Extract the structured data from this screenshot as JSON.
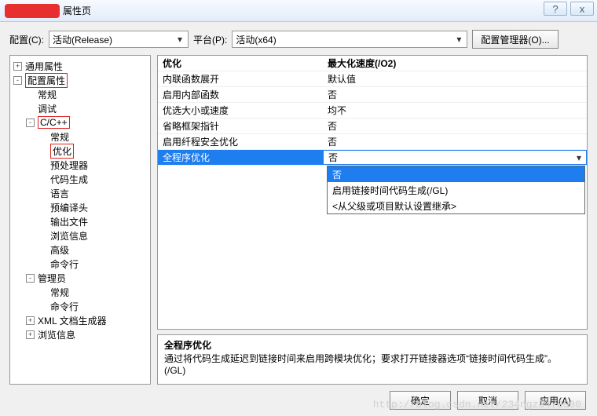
{
  "title": "属性页",
  "winbtns": {
    "help": "?",
    "close": "x"
  },
  "toprow": {
    "config_label": "配置(C):",
    "config_value": "活动(Release)",
    "platform_label": "平台(P):",
    "platform_value": "活动(x64)",
    "mgr_button": "配置管理器(O)..."
  },
  "tree": [
    {
      "lvl": 0,
      "exp": "+",
      "label": "通用属性",
      "box": false
    },
    {
      "lvl": 0,
      "exp": "-",
      "label": "配置属性",
      "box": true
    },
    {
      "lvl": 1,
      "exp": "",
      "label": "常规",
      "box": false
    },
    {
      "lvl": 1,
      "exp": "",
      "label": "调试",
      "box": false
    },
    {
      "lvl": 1,
      "exp": "-",
      "label": "C/C++",
      "box": true
    },
    {
      "lvl": 2,
      "exp": "",
      "label": "常规",
      "box": false
    },
    {
      "lvl": 2,
      "exp": "",
      "label": "优化",
      "box": true
    },
    {
      "lvl": 2,
      "exp": "",
      "label": "预处理器",
      "box": false
    },
    {
      "lvl": 2,
      "exp": "",
      "label": "代码生成",
      "box": false
    },
    {
      "lvl": 2,
      "exp": "",
      "label": "语言",
      "box": false
    },
    {
      "lvl": 2,
      "exp": "",
      "label": "预编译头",
      "box": false
    },
    {
      "lvl": 2,
      "exp": "",
      "label": "输出文件",
      "box": false
    },
    {
      "lvl": 2,
      "exp": "",
      "label": "浏览信息",
      "box": false
    },
    {
      "lvl": 2,
      "exp": "",
      "label": "高级",
      "box": false
    },
    {
      "lvl": 2,
      "exp": "",
      "label": "命令行",
      "box": false
    },
    {
      "lvl": 1,
      "exp": "-",
      "label": "管理员",
      "box": false
    },
    {
      "lvl": 2,
      "exp": "",
      "label": "常规",
      "box": false
    },
    {
      "lvl": 2,
      "exp": "",
      "label": "命令行",
      "box": false
    },
    {
      "lvl": 1,
      "exp": "+",
      "label": "XML 文档生成器",
      "box": false
    },
    {
      "lvl": 1,
      "exp": "+",
      "label": "浏览信息",
      "box": false
    }
  ],
  "grid": {
    "rows": [
      {
        "name": "优化",
        "value": "最大化速度(/O2)",
        "head": true
      },
      {
        "name": "内联函数展开",
        "value": "默认值"
      },
      {
        "name": "启用内部函数",
        "value": "否"
      },
      {
        "name": "优选大小或速度",
        "value": "均不"
      },
      {
        "name": "省略框架指针",
        "value": "否"
      },
      {
        "name": "启用纤程安全优化",
        "value": "否"
      },
      {
        "name": "全程序优化",
        "value": "否",
        "sel": true,
        "dd": true
      }
    ]
  },
  "popup": [
    {
      "label": "否",
      "sel": true
    },
    {
      "label": "启用链接时间代码生成(/GL)"
    },
    {
      "label": "<从父级或项目默认设置继承>"
    }
  ],
  "desc": {
    "title": "全程序优化",
    "body": "通过将代码生成延迟到链接时间来启用跨模块优化；要求打开链接器选项“链接时间代码生成”。    (/GL)"
  },
  "buttons": {
    "ok": "确定",
    "cancel": "取消",
    "apply": "应用(A)"
  },
  "watermark": "http://blog.csdn.net/234ngz3470000"
}
